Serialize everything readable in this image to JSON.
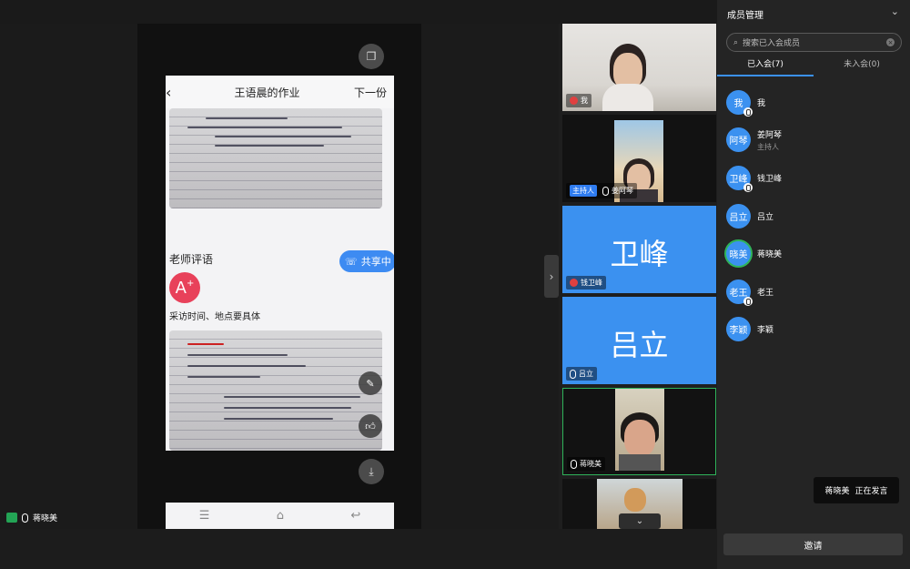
{
  "homework": {
    "title": "王语晨的作业",
    "next_label": "下一份",
    "back_icon": "chevron-left-icon",
    "comment_section_title": "老师评语",
    "sharing_label": "共享中",
    "grade": "A",
    "grade_suffix": "+",
    "comment_text": "采访时间、地点要具体"
  },
  "speaker": {
    "name": "蒋晓美"
  },
  "video_tiles": [
    {
      "name": "我",
      "is_host": false
    },
    {
      "name": "姜阿琴",
      "is_host": true,
      "host_label": "主持人"
    },
    {
      "name": "钱卫峰",
      "big_name": "卫峰"
    },
    {
      "name": "吕立",
      "big_name": "吕立"
    },
    {
      "name": "蒋晓美",
      "active_speaker": true
    },
    {
      "name": ""
    }
  ],
  "panel": {
    "title": "成员管理",
    "search_placeholder": "搜索已入会成员",
    "tabs": [
      {
        "label": "已入会(7)",
        "active": true
      },
      {
        "label": "未入会(0)",
        "active": false
      }
    ],
    "members": [
      {
        "avatar_text": "我",
        "name": "我",
        "role": ""
      },
      {
        "avatar_text": "阿琴",
        "name": "姜阿琴",
        "role": "主持人"
      },
      {
        "avatar_text": "卫峰",
        "name": "钱卫峰",
        "role": ""
      },
      {
        "avatar_text": "吕立",
        "name": "吕立",
        "role": ""
      },
      {
        "avatar_text": "晓美",
        "name": "蒋晓美",
        "role": ""
      },
      {
        "avatar_text": "老王",
        "name": "老王",
        "role": ""
      },
      {
        "avatar_text": "李颖",
        "name": "李颖",
        "role": ""
      }
    ],
    "speaking_toast_name": "蒋晓美",
    "speaking_toast_status": "正在发言",
    "invite_label": "邀请"
  },
  "colors": {
    "accent_blue": "#3b91f0",
    "active_green": "#2fb35a",
    "grade_red": "#e8415a"
  }
}
